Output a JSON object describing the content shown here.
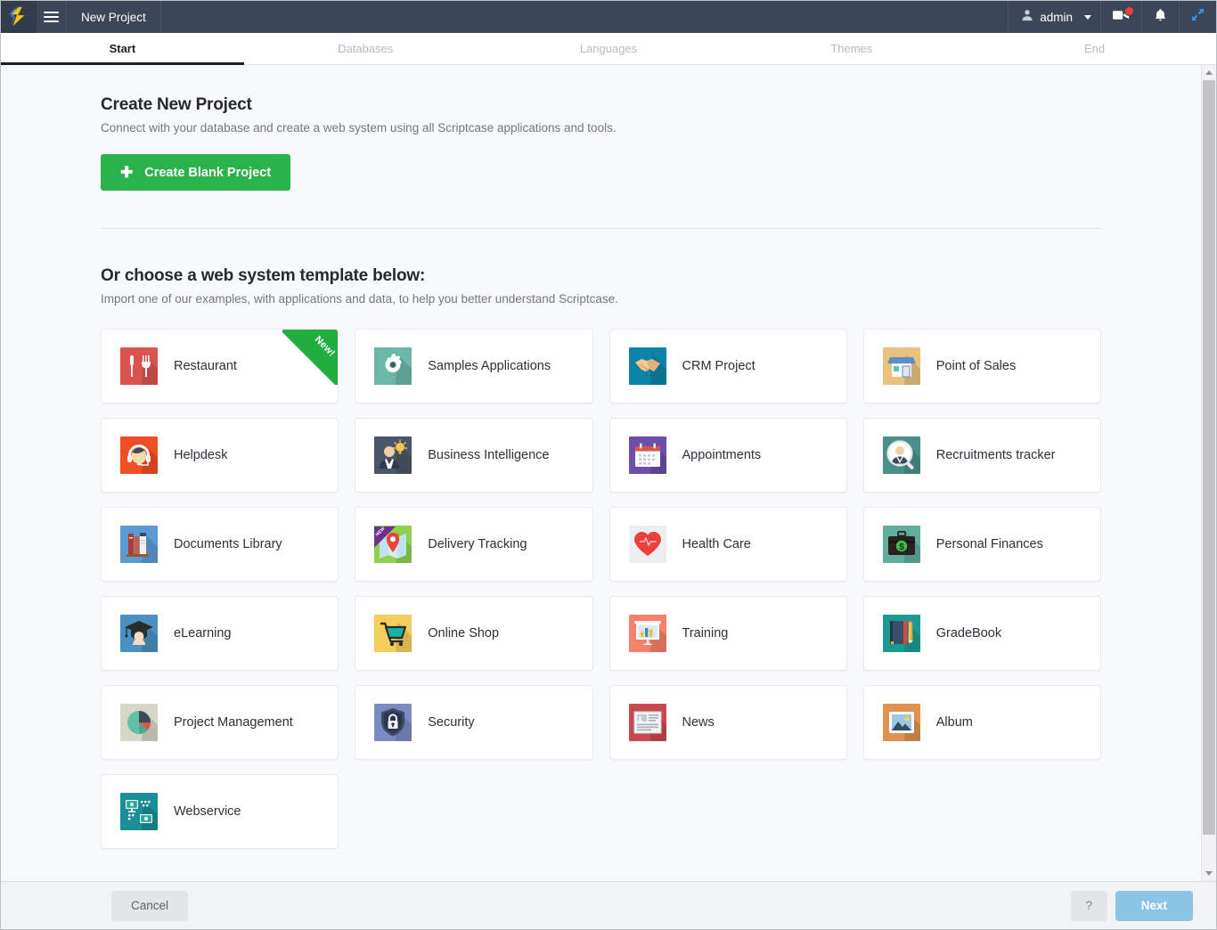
{
  "topbar": {
    "logo_icon": "scriptcase-logo-icon",
    "menu_icon": "hamburger-menu-icon",
    "project_name": "New Project",
    "user_icon": "user-icon",
    "user_label": "admin",
    "user_caret_icon": "chevron-down-icon",
    "video_icon": "video-camera-icon",
    "video_badge": "",
    "bell_icon": "bell-notification-icon",
    "expand_icon": "expand-fullscreen-icon"
  },
  "wizard_tabs": [
    {
      "label": "Start",
      "active": true
    },
    {
      "label": "Databases",
      "active": false
    },
    {
      "label": "Languages",
      "active": false
    },
    {
      "label": "Themes",
      "active": false
    },
    {
      "label": "End",
      "active": false
    }
  ],
  "create_section": {
    "title": "Create New Project",
    "subtitle": "Connect with your database and create a web system using all Scriptcase applications and tools.",
    "button_label": "Create Blank Project",
    "button_icon": "plus-icon",
    "button_color": "#29b34a"
  },
  "templates_section": {
    "title": "Or choose a web system template below:",
    "subtitle": "Import one of our examples, with applications and data, to help you better understand Scriptcase."
  },
  "templates": [
    {
      "label": "Restaurant",
      "icon": "restaurant-icon",
      "bg": "#d9534f",
      "ribbon": "New!",
      "ribbon_color": "green"
    },
    {
      "label": "Samples Applications",
      "icon": "gear-icon",
      "bg": "#6bb8a8",
      "ribbon": "",
      "ribbon_color": ""
    },
    {
      "label": "CRM Project",
      "icon": "handshake-icon",
      "bg": "#0d83a8",
      "ribbon": "",
      "ribbon_color": ""
    },
    {
      "label": "Point of Sales",
      "icon": "storefront-icon",
      "bg": "#e8c37e",
      "ribbon": "",
      "ribbon_color": ""
    },
    {
      "label": "Helpdesk",
      "icon": "headset-support-icon",
      "bg": "#f04e23",
      "ribbon": "",
      "ribbon_color": ""
    },
    {
      "label": "Business Intelligence",
      "icon": "businessman-idea-icon",
      "bg": "#4a5568",
      "ribbon": "",
      "ribbon_color": ""
    },
    {
      "label": "Appointments",
      "icon": "calendar-icon",
      "bg": "#6b4fa8",
      "ribbon": "",
      "ribbon_color": ""
    },
    {
      "label": "Recruitments tracker",
      "icon": "person-magnifier-icon",
      "bg": "#4a8f8a",
      "ribbon": "",
      "ribbon_color": ""
    },
    {
      "label": "Documents Library",
      "icon": "books-icon",
      "bg": "#5b9bd5",
      "ribbon": "",
      "ribbon_color": ""
    },
    {
      "label": "Delivery Tracking",
      "icon": "map-pin-icon",
      "bg": "#8fd14f",
      "ribbon": "NEW",
      "ribbon_color": "purple"
    },
    {
      "label": "Health Care",
      "icon": "heart-pulse-icon",
      "bg": "#eceef0",
      "ribbon": "",
      "ribbon_color": ""
    },
    {
      "label": "Personal Finances",
      "icon": "briefcase-money-icon",
      "bg": "#5fae9e",
      "ribbon": "",
      "ribbon_color": ""
    },
    {
      "label": "eLearning",
      "icon": "graduation-cap-icon",
      "bg": "#4a90c2",
      "ribbon": "",
      "ribbon_color": ""
    },
    {
      "label": "Online Shop",
      "icon": "shopping-cart-icon",
      "bg": "#f5cf5e",
      "ribbon": "",
      "ribbon_color": ""
    },
    {
      "label": "Training",
      "icon": "presentation-chart-icon",
      "bg": "#f4816a",
      "ribbon": "",
      "ribbon_color": ""
    },
    {
      "label": "GradeBook",
      "icon": "notebook-pencil-icon",
      "bg": "#1a9a92",
      "ribbon": "",
      "ribbon_color": ""
    },
    {
      "label": "Project Management",
      "icon": "pie-chart-icon",
      "bg": "#d8d6c7",
      "ribbon": "",
      "ribbon_color": ""
    },
    {
      "label": "Security",
      "icon": "shield-lock-icon",
      "bg": "#7c8ac4",
      "ribbon": "",
      "ribbon_color": ""
    },
    {
      "label": "News",
      "icon": "newspaper-icon",
      "bg": "#c9474f",
      "ribbon": "",
      "ribbon_color": ""
    },
    {
      "label": "Album",
      "icon": "photo-image-icon",
      "bg": "#e0924e",
      "ribbon": "",
      "ribbon_color": ""
    },
    {
      "label": "Webservice",
      "icon": "network-monitors-icon",
      "bg": "#1a8f95",
      "ribbon": "",
      "ribbon_color": ""
    }
  ],
  "footer": {
    "cancel_label": "Cancel",
    "help_label": "?",
    "next_label": "Next",
    "next_color": "#8bc4e6"
  },
  "scrollbar": {
    "up_icon": "scroll-up-arrow-icon",
    "down_icon": "scroll-down-arrow-icon"
  }
}
